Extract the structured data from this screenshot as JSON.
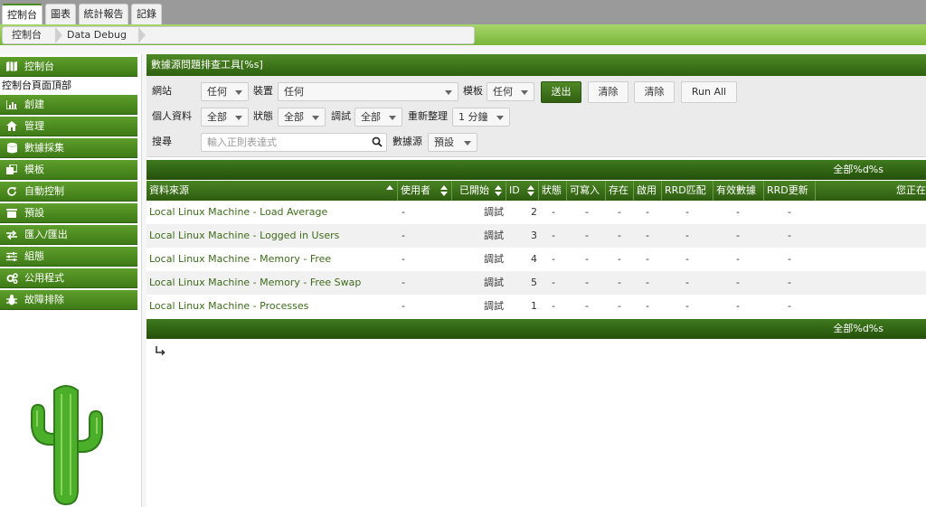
{
  "top_tabs": [
    "控制台",
    "圖表",
    "統計報告",
    "記錄"
  ],
  "breadcrumb": [
    "控制台",
    "Data Debug"
  ],
  "sidebar": {
    "items": [
      {
        "label": "控制台",
        "icon": "map-icon"
      },
      {
        "label": "創建",
        "icon": "chart-icon"
      },
      {
        "label": "管理",
        "icon": "home-icon"
      },
      {
        "label": "數據採集",
        "icon": "database-icon"
      },
      {
        "label": "模板",
        "icon": "copy-icon"
      },
      {
        "label": "自動控制",
        "icon": "refresh-icon"
      },
      {
        "label": "預設",
        "icon": "folder-icon"
      },
      {
        "label": "匯入/匯出",
        "icon": "exchange-icon"
      },
      {
        "label": "組態",
        "icon": "sliders-icon"
      },
      {
        "label": "公用程式",
        "icon": "cogs-icon"
      },
      {
        "label": "故障排除",
        "icon": "bug-icon"
      }
    ],
    "subitem": "控制台頁面頂部"
  },
  "panel_title": "數據源問題排查工具[%s]",
  "filters": {
    "site_label": "網站",
    "site_value": "任何",
    "device_label": "裝置",
    "device_value": "任何",
    "template_label": "模板",
    "template_value": "任何",
    "submit": "送出",
    "clear1": "清除",
    "clear2": "清除",
    "run_all": "Run All",
    "profile_label": "個人資料",
    "profile_value": "全部",
    "status_label": "狀態",
    "status_value": "全部",
    "debug_label": "調試",
    "debug_value": "全部",
    "refresh_label": "重新整理",
    "refresh_value": "1 分鐘",
    "search_label": "搜尋",
    "search_placeholder": "輸入正則表達式",
    "datasource_label": "數據源",
    "datasource_value": "預設"
  },
  "table": {
    "nav_text": "全部%d%s",
    "columns": [
      "資料來源",
      "使用者",
      "已開始",
      "ID",
      "狀態",
      "可寫入",
      "存在",
      "啟用",
      "RRD匹配",
      "有效數據",
      "RRD更新",
      "您正在"
    ],
    "rows": [
      {
        "source": "Local Linux Machine - Load Average",
        "user": "-",
        "started": "調試",
        "id": "2",
        "status": "-",
        "writable": "-",
        "exists": "-",
        "enabled": "-",
        "rrd_match": "-",
        "valid": "-",
        "rrd_update": "-"
      },
      {
        "source": "Local Linux Machine - Logged in Users",
        "user": "-",
        "started": "調試",
        "id": "3",
        "status": "-",
        "writable": "-",
        "exists": "-",
        "enabled": "-",
        "rrd_match": "-",
        "valid": "-",
        "rrd_update": "-"
      },
      {
        "source": "Local Linux Machine - Memory - Free",
        "user": "-",
        "started": "調試",
        "id": "4",
        "status": "-",
        "writable": "-",
        "exists": "-",
        "enabled": "-",
        "rrd_match": "-",
        "valid": "-",
        "rrd_update": "-"
      },
      {
        "source": "Local Linux Machine - Memory - Free Swap",
        "user": "-",
        "started": "調試",
        "id": "5",
        "status": "-",
        "writable": "-",
        "exists": "-",
        "enabled": "-",
        "rrd_match": "-",
        "valid": "-",
        "rrd_update": "-"
      },
      {
        "source": "Local Linux Machine - Processes",
        "user": "-",
        "started": "調試",
        "id": "1",
        "status": "-",
        "writable": "-",
        "exists": "-",
        "enabled": "-",
        "rrd_match": "-",
        "valid": "-",
        "rrd_update": "-"
      }
    ]
  },
  "colors": {
    "accent_green": "#3e7a17",
    "link_green": "#3d6b1b",
    "cactus_green": "#4caf2a"
  }
}
